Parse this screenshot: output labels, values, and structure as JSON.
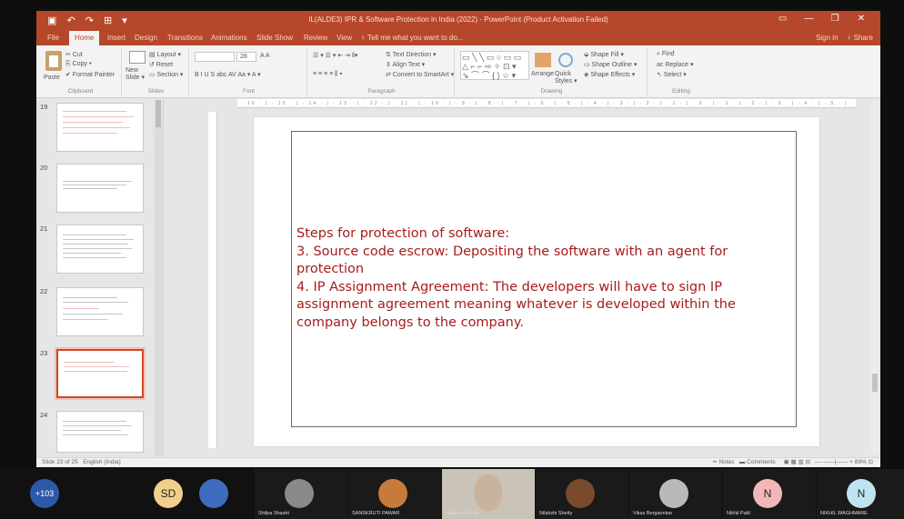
{
  "window": {
    "title": "IL(ALDE3) IPR & Software Protection in India (2022) - PowerPoint (Product Activation Failed)",
    "qat": "▣ ↶ ↷ ⊞ ▾",
    "controls": [
      "▭",
      "—",
      "❐",
      "✕"
    ]
  },
  "tabs": {
    "items": [
      "File",
      "Home",
      "Insert",
      "Design",
      "Transitions",
      "Animations",
      "Slide Show",
      "Review",
      "View"
    ],
    "active": "Home",
    "tell_me": "♀ Tell me what you want to do...",
    "sign_in": "Sign in",
    "share": "♀ Share"
  },
  "ribbon": {
    "clipboard": {
      "paste": "Paste",
      "cut": "✂ Cut",
      "copy": "⎘ Copy ▾",
      "format_painter": "✔ Format Painter",
      "name": "Clipboard"
    },
    "slides": {
      "new_slide": "New Slide ▾",
      "layout": "▤ Layout ▾",
      "reset": "↺ Reset",
      "section": "▭ Section ▾",
      "name": "Slides"
    },
    "font": {
      "size": "28",
      "grow_shrink": "A A",
      "format": "B I U S abc AV Aa ▾  A ▾",
      "name": "Font"
    },
    "paragraph": {
      "lists": "☰ ▾ ☰ ▾ ⇤ ⇥ ‖▾",
      "text_direction": "⇅ Text Direction ▾",
      "align_text": "⇕ Align Text ▾",
      "smartart": "⇄ Convert to SmartArt ▾",
      "alignment": "≡ ≡ ≡ ≡ ⫼ ▾",
      "name": "Paragraph"
    },
    "drawing": {
      "shapes": "▭ ╲ ╲ ▭ ○ ▭ ▭\n△ ⌐ ⌐ ⇨ ✧ ⊡ ▾\n⇘ ⌒ ⌒ { } ☆ ▾",
      "arrange": "Arrange",
      "quick_styles": "Quick Styles ▾",
      "shape_fill": "⬙ Shape Fill ▾",
      "shape_outline": "▭ Shape Outline ▾",
      "shape_effects": "◈ Shape Effects ▾",
      "name": "Drawing"
    },
    "editing": {
      "find": "⌕ Find",
      "replace": "ac Replace ▾",
      "select": "↖ Select ▾",
      "name": "Editing"
    }
  },
  "thumbnails": [
    {
      "num": "19"
    },
    {
      "num": "20"
    },
    {
      "num": "21"
    },
    {
      "num": "22"
    },
    {
      "num": "23"
    },
    {
      "num": "24"
    }
  ],
  "ruler": "· 16 · | · 15 · | · 14 · | · 13 · | · 12 · | · 11 · | · 10 · | · 9 · | · 8 · | · 7 · | · 6 · | · 5 · | · 4 · | · 3 · | · 2 · | · 1 · | · 0 · | · 1 · | · 2 · | · 3 · | · 4 · | · 5 · | · 6 · | · 7 · | · 8 · | · 9 · | · 10 · | · 11 · | · 12 · | · 13 · | · 14 · | · 15 · | · 16 ·",
  "slide": {
    "lines": [
      "Steps for protection of software:",
      "3. Source code escrow: Depositing the software with an agent for",
      "protection",
      "4. IP Assignment Agreement: The developers will have to sign IP",
      "assignment agreement meaning whatever is developed within the",
      "company belongs to the company."
    ]
  },
  "status": {
    "slide_info": "Slide 23 of 25",
    "language": "English (India)",
    "notes": "≐ Notes",
    "comments": "▬ Comments",
    "zoom": "— ——|—— + 89% ⊡"
  },
  "participants": [
    {
      "label": "+103",
      "type": "count",
      "color": "#2d5aa8"
    },
    {
      "label": "SD",
      "type": "initials",
      "color": "#f2cf8a",
      "name": ""
    },
    {
      "label": "",
      "type": "photo",
      "color": "#3e6dbf",
      "name": ""
    },
    {
      "label": "",
      "type": "photo",
      "color": "#8a8a8a",
      "name": "Shilpa Shastri"
    },
    {
      "label": "",
      "type": "photo",
      "color": "#c77b3b",
      "name": "SANSKRUTI PAWAR"
    },
    {
      "label": "",
      "type": "video",
      "color": "#c9b39c",
      "name": "Nilakshi Shetty"
    },
    {
      "label": "",
      "type": "photo",
      "color": "#7a4a2c",
      "name": "Nilakshi Shetty"
    },
    {
      "label": "",
      "type": "photo",
      "color": "#b9b9b9",
      "name": "Vikas Bergaonkar"
    },
    {
      "label": "N",
      "type": "initials",
      "color": "#f2b8b8",
      "name": "Nikhil Patil"
    },
    {
      "label": "N",
      "type": "initials",
      "color": "#bfe3f0",
      "name": "NIKHIL WAGHMARE"
    }
  ]
}
